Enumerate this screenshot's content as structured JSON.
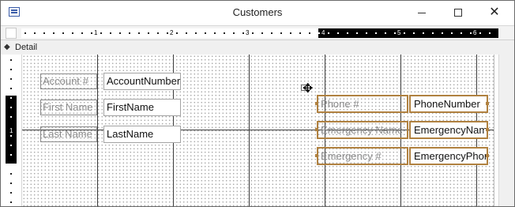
{
  "window": {
    "title": "Customers"
  },
  "icons": {
    "app": "form-design-icon",
    "minimize": "minimize-icon",
    "maximize": "maximize-icon",
    "close": "close-icon",
    "section_toggle": "section-expand-icon",
    "cursor": "move-cursor-icon"
  },
  "controls": {
    "close_glyph": "✕"
  },
  "ruler": {
    "numbers": [
      "1",
      "2",
      "3",
      "4",
      "5",
      "6"
    ]
  },
  "vertical_ruler": {
    "number": "1"
  },
  "section": {
    "arrow": "◆",
    "label": "Detail"
  },
  "form": {
    "labels": {
      "account": "Account #",
      "first_name": "First Name",
      "last_name": "Last Name",
      "phone": "Phone #",
      "emergency_name": "Emergency Name",
      "emergency_phone": "Emergency #"
    },
    "fields": {
      "account": "AccountNumber",
      "first_name": "FirstName",
      "last_name": "LastName",
      "phone": "PhoneNumber",
      "emergency_name": "EmergencyName",
      "emergency_phone": "EmergencyPhone"
    }
  },
  "colors": {
    "selection": "#b08140"
  }
}
